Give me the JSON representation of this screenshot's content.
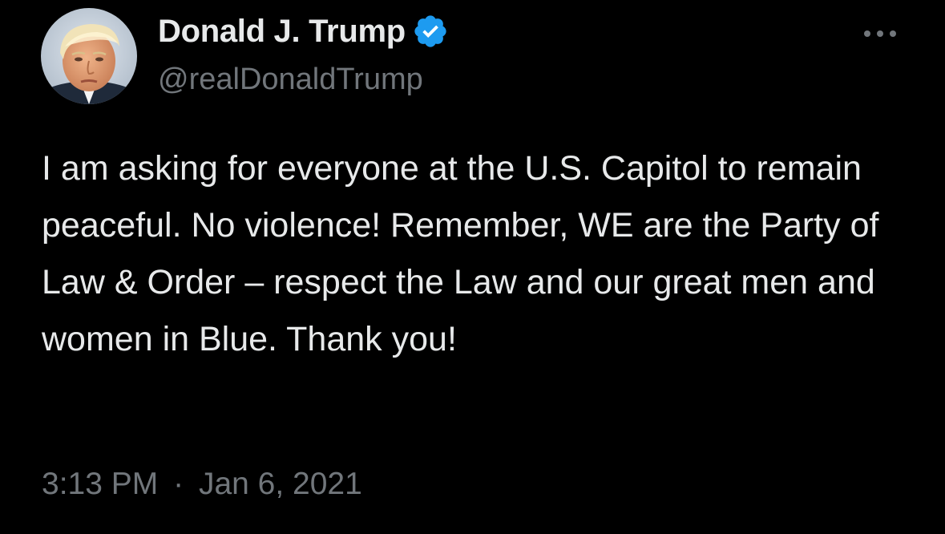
{
  "tweet": {
    "author": {
      "display_name": "Donald J. Trump",
      "handle": "@realDonaldTrump",
      "verified": true,
      "verified_color": "#1d9bf0",
      "avatar": "profile-photo"
    },
    "text": "I am asking for everyone at the U.S. Capitol to remain peaceful. No violence! Remember, WE are the Party of Law & Order – respect the Law and our great men and women in Blue. Thank you!",
    "time": "3:13 PM",
    "separator": "·",
    "date": "Jan 6, 2021",
    "more_icon": "more-horizontal-icon"
  },
  "colors": {
    "background": "#000000",
    "primary_text": "#e7e9ea",
    "secondary_text": "#71767b",
    "accent": "#1d9bf0"
  }
}
